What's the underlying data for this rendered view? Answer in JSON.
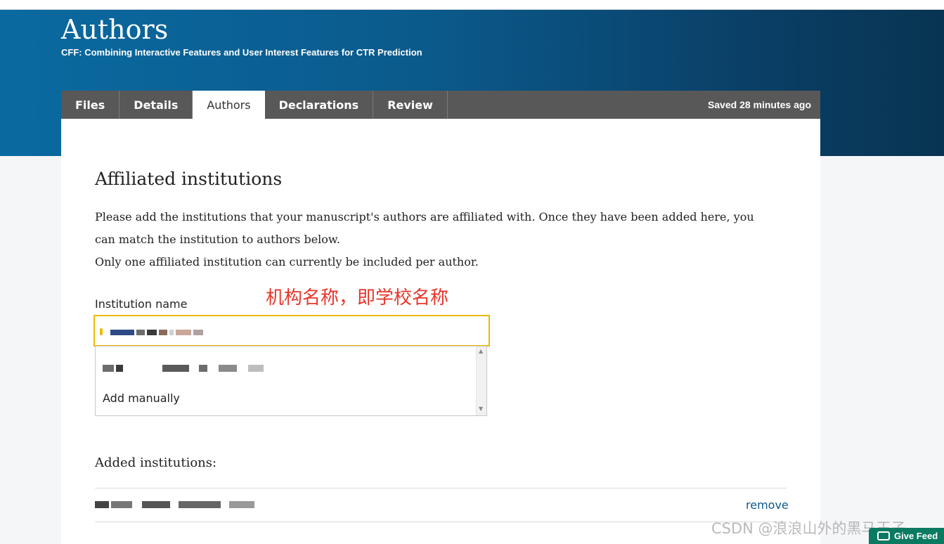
{
  "header": {
    "title": "Authors",
    "subtitle": "CFF: Combining Interactive Features and User Interest Features for CTR Prediction"
  },
  "tabs": [
    {
      "label": "Files",
      "active": false
    },
    {
      "label": "Details",
      "active": false
    },
    {
      "label": "Authors",
      "active": true
    },
    {
      "label": "Declarations",
      "active": false
    },
    {
      "label": "Review",
      "active": false
    }
  ],
  "saved_status": "Saved 28 minutes ago",
  "affiliations": {
    "title": "Affiliated institutions",
    "description_1": "Please add the institutions that your manuscript's authors are affiliated with. Once they have been added here, you can match the institution to authors below.",
    "description_2": "Only one affiliated institution can currently be included per author.",
    "field_label": "Institution name",
    "annotation": "机构名称，即学校名称",
    "dropdown": {
      "add_manually_label": "Add manually"
    },
    "added_title": "Added institutions:",
    "remove_label": "remove"
  },
  "watermark": "CSDN @浪浪山外的黑马王子",
  "feedback_label": "Give Feed",
  "colors": {
    "banner": "#0b5a8c",
    "tabbar": "#585858",
    "focus_border": "#f0b800",
    "annotation": "#e8352a",
    "link": "#0a5a8c",
    "feedback": "#0b7a62"
  }
}
